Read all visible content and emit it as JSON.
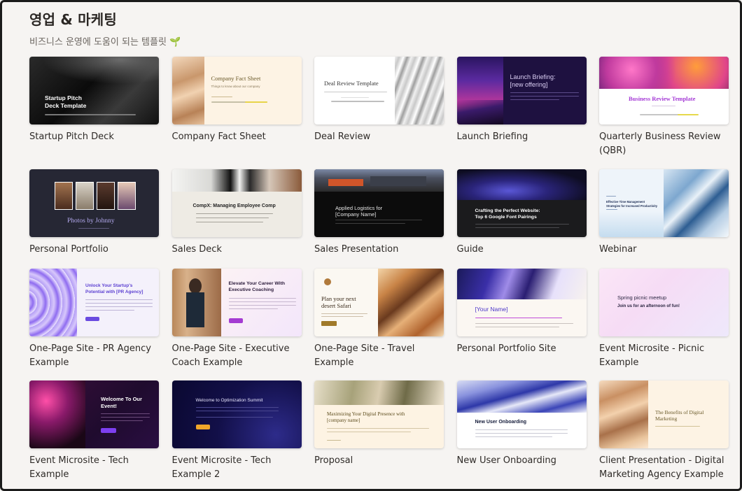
{
  "header": {
    "title": "영업 & 마케팅",
    "subtitle": "비즈니스 운영에 도움이 되는 템플릿 🌱"
  },
  "templates": [
    {
      "label": "Startup Pitch Deck",
      "thumb": {
        "title": "Startup Pitch\nDeck Template"
      }
    },
    {
      "label": "Company Fact Sheet",
      "thumb": {
        "title": "Company Fact Sheet",
        "sub": "Things to know about our company"
      }
    },
    {
      "label": "Deal Review",
      "thumb": {
        "title": "Deal Review Template"
      }
    },
    {
      "label": "Launch Briefing",
      "thumb": {
        "title": "Launch Briefing:\n[new offering]"
      }
    },
    {
      "label": "Quarterly Business Review (QBR)",
      "thumb": {
        "title": "Business Review Template"
      }
    },
    {
      "label": "Personal Portfolio",
      "thumb": {
        "title": "Photos by Johnny"
      }
    },
    {
      "label": "Sales Deck",
      "thumb": {
        "title": "CompX: Managing Employee Comp"
      }
    },
    {
      "label": "Sales Presentation",
      "thumb": {
        "title": "Applied Logistics for\n[Company Name]"
      }
    },
    {
      "label": "Guide",
      "thumb": {
        "title": "Crafting the Perfect Website:\nTop 6 Google Font Pairings"
      }
    },
    {
      "label": "Webinar",
      "thumb": {
        "title": "Effective Time Management\nStrategies for Increased Productivity"
      }
    },
    {
      "label": "One-Page Site - PR Agency Example",
      "thumb": {
        "title": "Unlock Your Startup's\nPotential with [PR Agency]"
      }
    },
    {
      "label": "One-Page Site - Executive Coach Example",
      "thumb": {
        "title": "Elevate Your Career With\nExecutive Coaching"
      }
    },
    {
      "label": "One-Page Site - Travel Example",
      "thumb": {
        "title": "Plan your next\ndesert Safari"
      }
    },
    {
      "label": "Personal Portfolio Site",
      "thumb": {
        "title": "[Your Name]"
      }
    },
    {
      "label": "Event Microsite - Picnic Example",
      "thumb": {
        "title": "Spring picnic meetup",
        "sub": "Join us for an afternoon of fun!"
      }
    },
    {
      "label": "Event Microsite - Tech Example",
      "thumb": {
        "title": "Welcome To Our\nEvent!"
      }
    },
    {
      "label": "Event Microsite - Tech Example 2",
      "thumb": {
        "title": "Welcome to Optimization Summit"
      }
    },
    {
      "label": "Proposal",
      "thumb": {
        "title": "Maximizing Your Digital Presence with\n[company name]"
      }
    },
    {
      "label": "New User Onboarding",
      "thumb": {
        "title": "New User Onboarding"
      }
    },
    {
      "label": "Client Presentation - Digital Marketing Agency Example",
      "thumb": {
        "title": "The Benefits of Digital\nMarketing"
      }
    }
  ]
}
